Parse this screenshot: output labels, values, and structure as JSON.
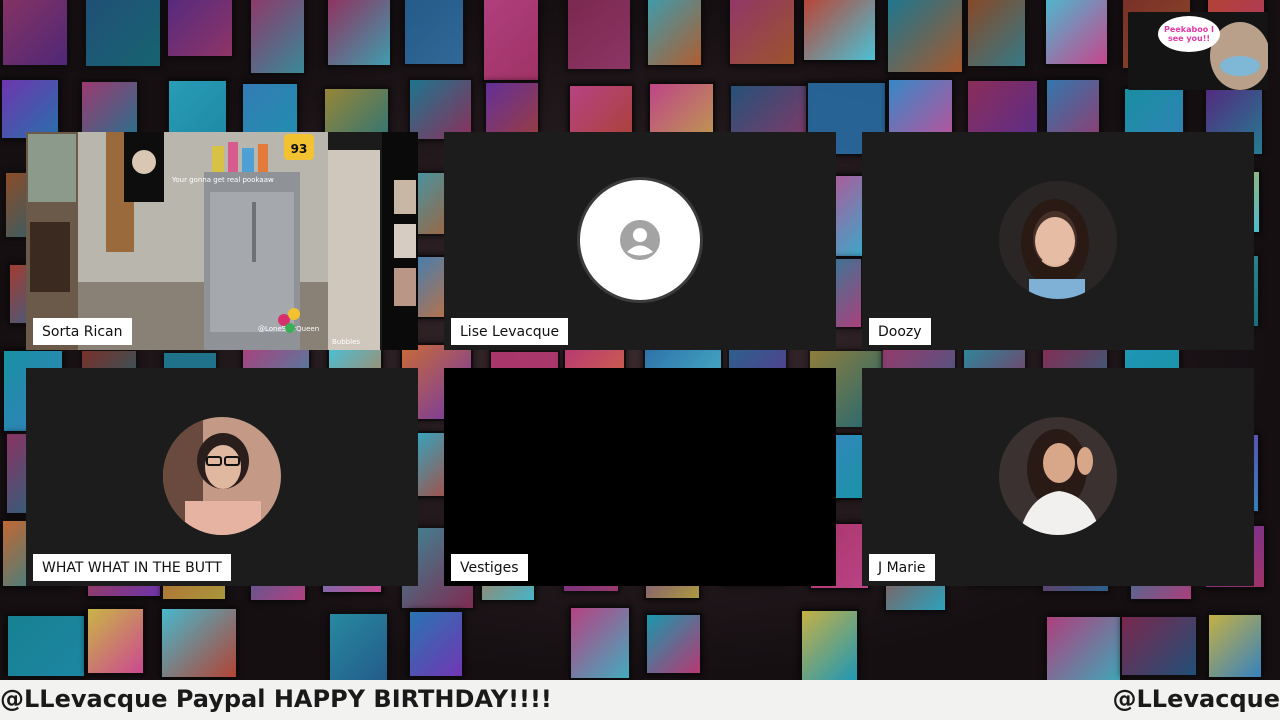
{
  "participants": [
    {
      "name": "Sorta Rican",
      "type": "video"
    },
    {
      "name": "Lise Levacque",
      "type": "placeholder"
    },
    {
      "name": "Doozy",
      "type": "photo"
    },
    {
      "name": "WHAT WHAT IN THE BUTT",
      "type": "photo"
    },
    {
      "name": "Vestiges",
      "type": "black"
    },
    {
      "name": "J Marie",
      "type": "photo"
    }
  ],
  "video_feed": {
    "overlay_text": "Your gonna get real pookaaw",
    "handle": "@LoneStarQueen",
    "suffix": "Bubbles",
    "badge": "93"
  },
  "corner_overlay": {
    "bubble_text": "Peekaboo I see you!!"
  },
  "ticker": {
    "left_text": "@LLevacque Paypal HAPPY BIRTHDAY!!!!",
    "right_text": "@LLevacque"
  },
  "colors": {
    "tile_bg": "#1c1c1c",
    "label_bg": "#ffffff",
    "ticker_bg": "#f2f2f0",
    "accent_pink": "#e23aa6"
  }
}
